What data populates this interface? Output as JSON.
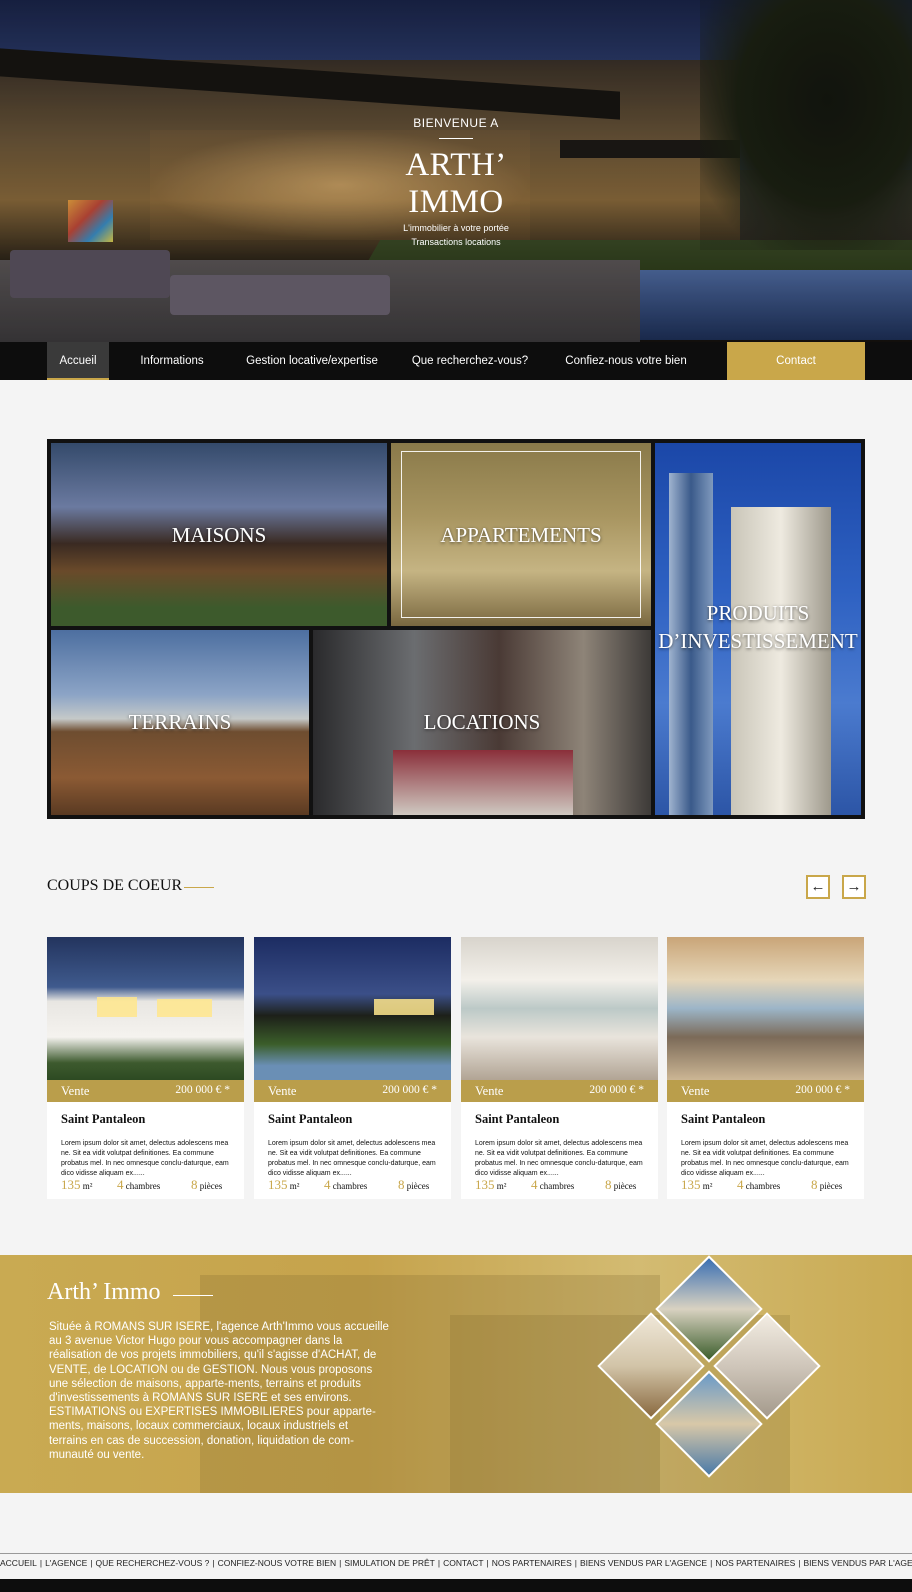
{
  "hero": {
    "kicker": "BIENVENUE A",
    "title": "ARTH’ IMMO",
    "subtitle_1": "L'immobilier à votre portée",
    "subtitle_2": "Transactions locations"
  },
  "nav": {
    "items": [
      {
        "label": "Accueil"
      },
      {
        "label": "Informations"
      },
      {
        "label": "Gestion locative/expertise"
      },
      {
        "label": "Que recherchez-vous?"
      },
      {
        "label": "Confiez-nous votre bien"
      }
    ],
    "contact_label": "Contact",
    "accent_color": "#c9a74a"
  },
  "categories": {
    "maisons": "MAISONS",
    "appartements": "APPARTEMENTS",
    "produits_1": "PRODUITS",
    "produits_2": "D’INVESTISSEMENT",
    "terrains": "TERRAINS",
    "locations": "LOCATIONS"
  },
  "coups_de_coeur": {
    "title": "COUPS DE COEUR",
    "prev_icon": "arrow-left-icon",
    "next_icon": "arrow-right-icon",
    "cards": [
      {
        "type": "Vente",
        "price": "200 000 € *",
        "city": "Saint Pantaleon",
        "desc": "Lorem ipsum dolor sit amet, delectus adolescens mea ne. Sit ea vidit volutpat definitiones. Ea commune probatus mel. In nec omnesque conclu-daturque, eam dico vidisse aliquam ex......",
        "surface": "135",
        "surface_unit": "m²",
        "rooms": "4",
        "rooms_label": "chambres",
        "pieces": "8",
        "pieces_label": "pièces"
      },
      {
        "type": "Vente",
        "price": "200 000 € *",
        "city": "Saint Pantaleon",
        "desc": "Lorem ipsum dolor sit amet, delectus adolescens mea ne. Sit ea vidit volutpat definitiones. Ea commune probatus mel. In nec omnesque conclu-daturque, eam dico vidisse aliquam ex......",
        "surface": "135",
        "surface_unit": "m²",
        "rooms": "4",
        "rooms_label": "chambres",
        "pieces": "8",
        "pieces_label": "pièces"
      },
      {
        "type": "Vente",
        "price": "200 000 € *",
        "city": "Saint Pantaleon",
        "desc": "Lorem ipsum dolor sit amet, delectus adolescens mea ne. Sit ea vidit volutpat definitiones. Ea commune probatus mel. In nec omnesque conclu-daturque, eam dico vidisse aliquam ex......",
        "surface": "135",
        "surface_unit": "m²",
        "rooms": "4",
        "rooms_label": "chambres",
        "pieces": "8",
        "pieces_label": "pièces"
      },
      {
        "type": "Vente",
        "price": "200 000 € *",
        "city": "Saint Pantaleon",
        "desc": "Lorem ipsum dolor sit amet, delectus adolescens mea ne. Sit ea vidit volutpat definitiones. Ea commune probatus mel. In nec omnesque conclu-daturque, eam dico vidisse aliquam ex......",
        "surface": "135",
        "surface_unit": "m²",
        "rooms": "4",
        "rooms_label": "chambres",
        "pieces": "8",
        "pieces_label": "pièces"
      }
    ]
  },
  "about": {
    "title": "Arth’ Immo",
    "text": "Située à ROMANS SUR ISERE, l'agence Arth'Immo vous accueille au 3 avenue Victor Hugo pour vous accompagner dans la réalisation de vos projets immobiliers, qu'il s'agisse d'ACHAT, de VENTE, de LOCATION ou de GESTION. Nous vous proposons une sélection de maisons, apparte-ments, terrains et produits d'investissements à ROMANS SUR ISERE et ses environs. ESTIMATIONS ou EXPERTISES IMMOBILIERES pour apparte-ments, maisons, locaux commerciaux, locaux industriels et terrains en cas de succession, donation, liquidation de com-munauté ou vente."
  },
  "footer": {
    "links": [
      "ACCUEIL",
      "L'AGENCE",
      "QUE RECHERCHEZ-VOUS ?",
      "CONFIEZ-NOUS VOTRE BIEN",
      "SIMULATION DE PRÊT",
      "CONTACT",
      "NOS PARTENAIRES",
      "BIENS VENDUS PAR L'AGENCE",
      "NOS PARTENAIRES",
      "BIENS VENDUS PAR L'AGENCE"
    ],
    "separator": "|"
  }
}
